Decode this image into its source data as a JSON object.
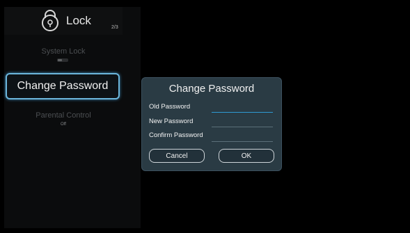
{
  "header": {
    "title": "Lock",
    "page_counter": "2/3"
  },
  "menu": {
    "system_lock": {
      "label": "System Lock",
      "state": "off"
    },
    "change_password": {
      "label": "Change Password"
    },
    "parental_control": {
      "label": "Parental Control",
      "value": "Off"
    }
  },
  "dialog": {
    "title": "Change Password",
    "fields": [
      {
        "label": "Old Password",
        "value": ""
      },
      {
        "label": "New Password",
        "value": ""
      },
      {
        "label": "Confirm Password",
        "value": ""
      }
    ],
    "cancel_label": "Cancel",
    "ok_label": "OK"
  },
  "colors": {
    "focus_border": "#6cb6dc",
    "dialog_bg": "#2a3b44",
    "input_focus": "#2f9bd3"
  }
}
